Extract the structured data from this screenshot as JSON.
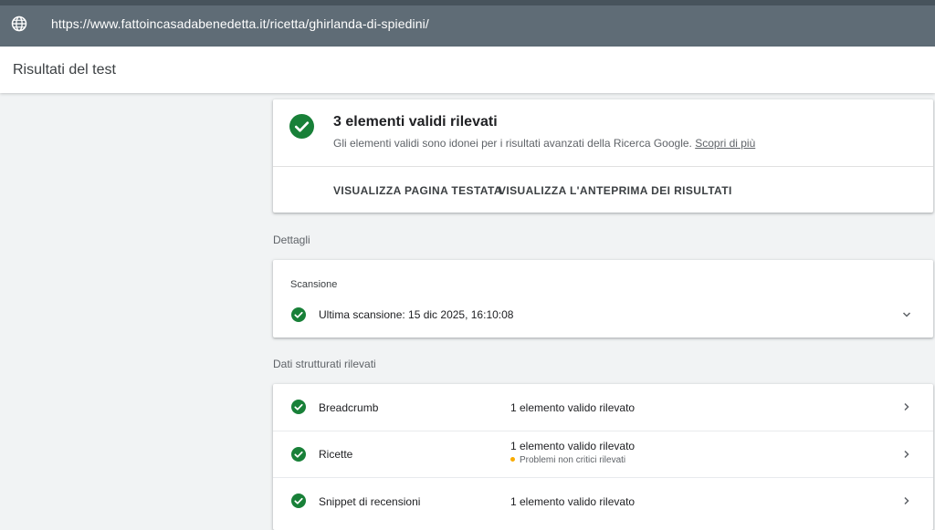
{
  "url_bar": {
    "url": "https://www.fattoincasadabenedetta.it/ricetta/ghirlanda-di-spiedini/"
  },
  "header": {
    "title": "Risultati del test"
  },
  "summary": {
    "heading": "3 elementi validi rilevati",
    "description": "Gli elementi validi sono idonei per i risultati avanzati della Ricerca Google.",
    "learn_more": "Scopri di più",
    "view_tested_page": "VISUALIZZA PAGINA TESTATA",
    "view_preview": "VISUALIZZA L'ANTEPRIMA DEI RISULTATI"
  },
  "details": {
    "label": "Dettagli",
    "scan_label": "Scansione",
    "last_scan": "Ultima scansione: 15 dic 2025, 16:10:08"
  },
  "structured_data": {
    "label": "Dati strutturati rilevati",
    "rows": [
      {
        "name": "Breadcrumb",
        "status": "1 elemento valido rilevato",
        "warning": ""
      },
      {
        "name": "Ricette",
        "status": "1 elemento valido rilevato",
        "warning": "Problemi non critici rilevati"
      },
      {
        "name": "Snippet di recensioni",
        "status": "1 elemento valido rilevato",
        "warning": ""
      }
    ]
  },
  "colors": {
    "success": "#188038",
    "warning": "#f9ab00",
    "url_bar": "#5f6c76"
  },
  "icons": [
    "globe-icon",
    "check-circle-icon",
    "chevron-down-icon",
    "chevron-right-icon"
  ]
}
